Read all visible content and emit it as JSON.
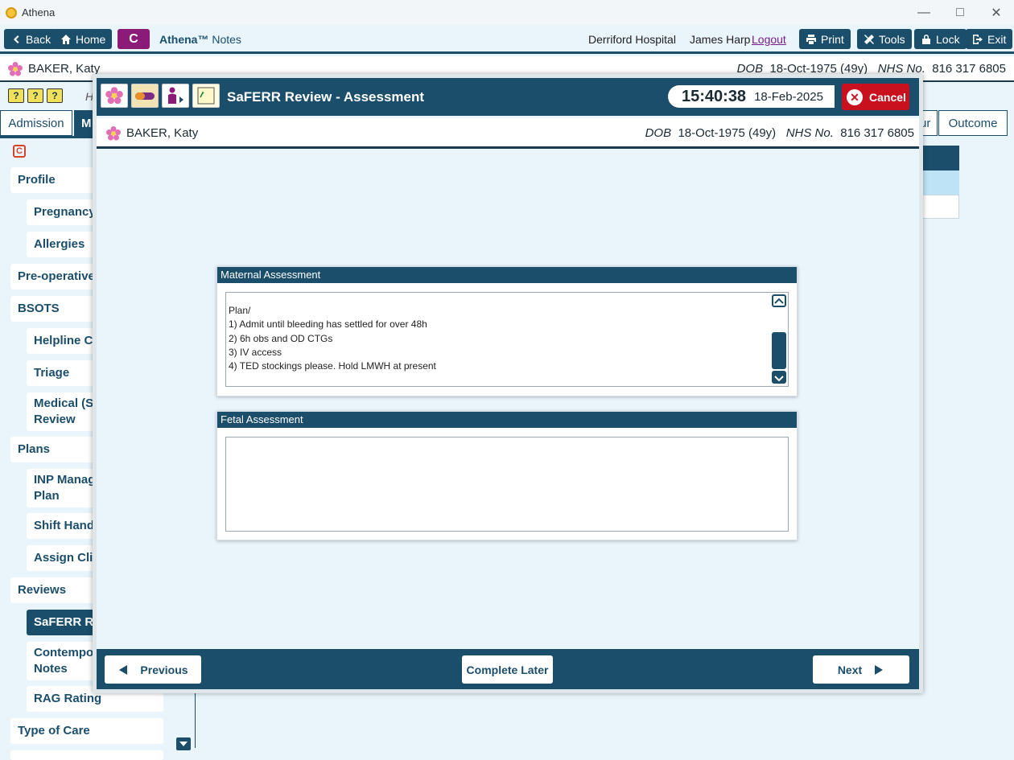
{
  "window": {
    "title": "Athena",
    "minimize_icon": "minimize-icon",
    "maximize_icon": "maximize-icon",
    "close_icon": "close-icon"
  },
  "toolbar": {
    "back_label": "Back",
    "home_label": "Home",
    "c_label": "C",
    "app_name": "Athena™",
    "app_section": "Notes",
    "hospital": "Derriford Hospital",
    "user": "James Harp",
    "logout_label": "Logout",
    "print_label": "Print",
    "tools_label": "Tools",
    "lock_label": "Lock",
    "exit_label": "Exit"
  },
  "patient": {
    "name": "BAKER, Katy",
    "dob_label": "DOB",
    "dob": "18-Oct-1975 (49y)",
    "nhs_label": "NHS No.",
    "nhs": "816 317 6805"
  },
  "background": {
    "help_icons": [
      "?",
      "?",
      "?"
    ],
    "hidden_label": "H",
    "tabs": [
      "Admission",
      "M",
      "ur",
      "Outcome"
    ]
  },
  "sidebar": {
    "badge": "C",
    "items": [
      "Profile",
      "Pregnancy",
      "Allergies",
      "Pre-operative",
      "BSOTS",
      "Helpline Co",
      "Triage",
      "Medical (Sa",
      "Review",
      "Plans",
      "INP Manag",
      "Plan",
      "Shift Hando",
      "Assign Clin",
      "Reviews",
      "SaFERR Rev",
      "Contempor",
      "Notes",
      "RAG Rating",
      "Type of Care"
    ]
  },
  "modal": {
    "title": "SaFERR Review - Assessment",
    "time": "15:40:38",
    "date": "18-Feb-2025",
    "cancel_label": "Cancel",
    "maternal_title": "Maternal Assessment",
    "maternal_lines": [
      "Plan/",
      "1) Admit until bleeding has settled for over 48h",
      "2) 6h obs and OD CTGs",
      "3) IV access",
      "4) TED stockings please. Hold LMWH at present"
    ],
    "fetal_title": "Fetal Assessment",
    "fetal_text": "",
    "previous_label": "Previous",
    "complete_later_label": "Complete Later",
    "next_label": "Next"
  },
  "colors": {
    "primary": "#1b4e6b",
    "cancel": "#c9101e",
    "c_button": "#8b1a78",
    "background": "#e9f4fb"
  }
}
